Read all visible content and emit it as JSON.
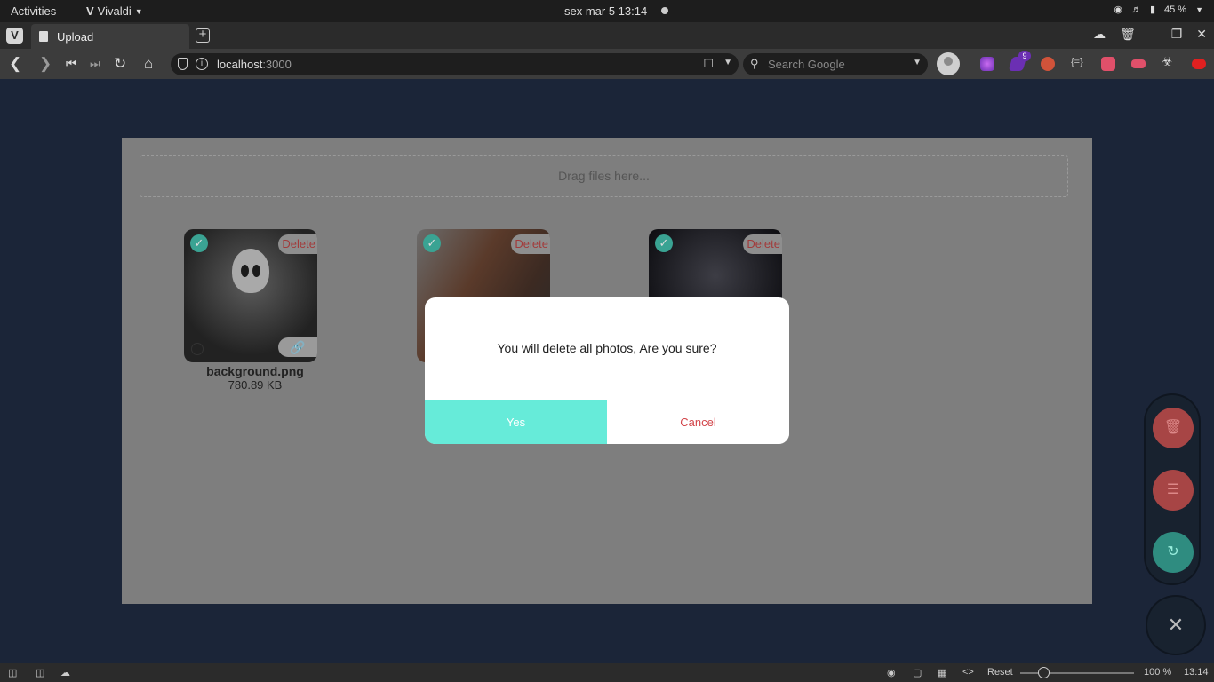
{
  "os": {
    "activities": "Activities",
    "app_name": "Vivaldi",
    "clock": "sex mar 5  13:14",
    "battery": "45 %"
  },
  "browser": {
    "tab_title": "Upload",
    "url_host": "localhost",
    "url_port": ":3000",
    "search_placeholder": "Search Google",
    "ext_badge": "9"
  },
  "page": {
    "dropzone_text": "Drag files here...",
    "photos": [
      {
        "delete_label": "Delete",
        "name": "background.png",
        "size": "780.89 KB"
      },
      {
        "delete_label": "Delete"
      },
      {
        "delete_label": "Delete"
      }
    ]
  },
  "modal": {
    "message": "You will delete all photos, Are you sure?",
    "yes_label": "Yes",
    "cancel_label": "Cancel"
  },
  "statusbar": {
    "reset": "Reset",
    "zoom": "100 %",
    "time": "13:14"
  },
  "colors": {
    "accent": "#66ebd9",
    "danger": "#d2454a",
    "page_bg": "#1b2538"
  }
}
